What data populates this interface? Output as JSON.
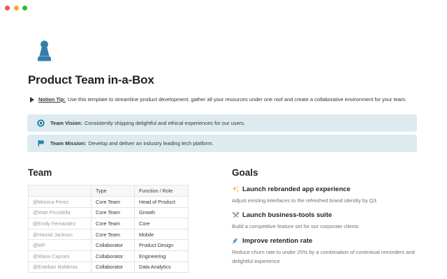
{
  "window": {
    "traffic_lights": [
      {
        "name": "close",
        "color": "#f4524a"
      },
      {
        "name": "minimize",
        "color": "#f6a821"
      },
      {
        "name": "zoom",
        "color": "#23c038"
      }
    ]
  },
  "page": {
    "icon": "pawn-icon",
    "title": "Product Team in-a-Box",
    "tip": {
      "toggle_icon": "triangle-right-icon",
      "label": "Notion Tip:",
      "text": "Use this template to streamline product development, gather all your resources under one roof and create a collaborative environment for your team."
    },
    "callouts": [
      {
        "icon": "nazar-amulet-icon",
        "label": "Team Vision:",
        "text": "Consistently shipping delightful and ethical experiences for our users."
      },
      {
        "icon": "flag-icon",
        "label": "Team Mission:",
        "text": "Develop and deliver an industry leading tech platform."
      }
    ],
    "team": {
      "heading": "Team",
      "table": {
        "headers": [
          "",
          "Type",
          "Function / Role"
        ],
        "rows": [
          [
            "@Monica Perez",
            "Core Team",
            "Head of Product"
          ],
          [
            "@Matt Piccolella",
            "Core Team",
            "Growth"
          ],
          [
            "@Emily Fernandez",
            "Core Team",
            "Core"
          ],
          [
            "@Harold Jackson",
            "Core Team",
            "Mobile"
          ],
          [
            "@MP",
            "Collaborator",
            "Product Design"
          ],
          [
            "@Maria Caprani",
            "Collaborator",
            "Engineering"
          ],
          [
            "@Esteban Balderas",
            "Collaborator",
            "Data Analytics"
          ]
        ]
      }
    },
    "goals": {
      "heading": "Goals",
      "items": [
        {
          "icon": "sparkles-icon",
          "title": "Launch rebranded app experience",
          "description": "Adjust existing interfaces to the refreshed brand identity by Q3."
        },
        {
          "icon": "hammer-and-wrench-icon",
          "title": "Launch business-tools suite",
          "description": "Build a competitive feature set for our corporate clients"
        },
        {
          "icon": "dolphin-icon",
          "title": "Improve retention rate",
          "description": "Reduce churn rate to under 25% by a combination of contextual reminders and delightful experience"
        }
      ]
    }
  },
  "colors": {
    "accent": "#337ea9",
    "text": "#37352f",
    "gray_text": "#73726e",
    "mention": "#9b9a97",
    "callout_bg": "#ddebf1",
    "border": "#e6e4e1",
    "header_bg": "#f7f7f5",
    "traffic_red": "#f4524a",
    "traffic_yellow": "#f6a821",
    "traffic_green": "#23c038"
  }
}
